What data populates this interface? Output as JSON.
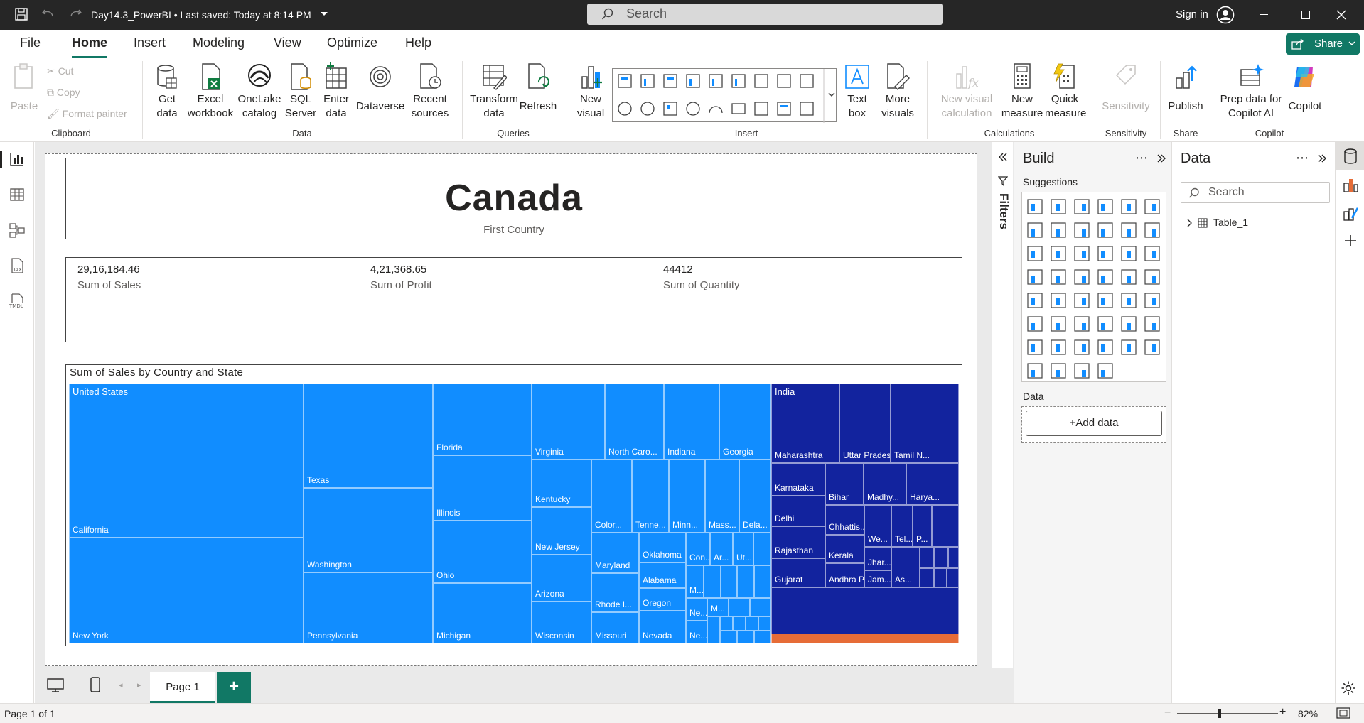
{
  "titlebar": {
    "doc_title": "Day14.3_PowerBI • Last saved: Today at 8:14 PM",
    "search_placeholder": "Search",
    "sign_in": "Sign in"
  },
  "tabs": [
    "File",
    "Home",
    "Insert",
    "Modeling",
    "View",
    "Optimize",
    "Help"
  ],
  "share_label": "Share",
  "ribbon": {
    "clipboard": {
      "paste": "Paste",
      "cut": "Cut",
      "copy": "Copy",
      "format_painter": "Format painter",
      "group": "Clipboard"
    },
    "data": {
      "get_data": "Get data",
      "excel": "Excel workbook",
      "onelake": "OneLake catalog",
      "sql": "SQL Server",
      "enter": "Enter data",
      "dataverse": "Dataverse",
      "recent": "Recent sources",
      "group": "Data"
    },
    "queries": {
      "transform": "Transform data",
      "refresh": "Refresh",
      "group": "Queries"
    },
    "insert": {
      "new_visual": "New visual",
      "text_box": "Text box",
      "more_visuals": "More visuals",
      "group": "Insert"
    },
    "calculations": {
      "new_visual_calc": "New visual calculation",
      "new_measure": "New measure",
      "quick_measure": "Quick measure",
      "group": "Calculations"
    },
    "sensitivity": {
      "label": "Sensitivity",
      "group": "Sensitivity"
    },
    "share": {
      "publish": "Publish",
      "group": "Share"
    },
    "copilot": {
      "prep": "Prep data for Copilot AI",
      "copilot": "Copilot",
      "group": "Copilot"
    }
  },
  "card": {
    "title": "Canada",
    "subtitle": "First Country"
  },
  "kpis": [
    {
      "value": "29,16,184.46",
      "label": "Sum of Sales"
    },
    {
      "value": "4,21,368.65",
      "label": "Sum of Profit"
    },
    {
      "value": "44412",
      "label": "Sum of Quantity"
    }
  ],
  "treemap": {
    "title": "Sum of Sales by Country and State",
    "colors": {
      "United States": "#118dff",
      "India": "#12239e",
      "Other": "#e66c37"
    },
    "labels": {
      "us": "United States",
      "in": "India",
      "california": "California",
      "newyork": "New York",
      "texas": "Texas",
      "washington": "Washington",
      "pennsylvania": "Pennsylvania",
      "florida": "Florida",
      "illinois": "Illinois",
      "ohio": "Ohio",
      "michigan": "Michigan",
      "virginia": "Virginia",
      "kentucky": "Kentucky",
      "newjersey": "New Jersey",
      "arizona": "Arizona",
      "wisconsin": "Wisconsin",
      "northcaro": "North Caro...",
      "indiana": "Indiana",
      "georgia": "Georgia",
      "colorado": "Color...",
      "tennessee": "Tenne...",
      "minnesota": "Minn...",
      "massachusetts": "Mass...",
      "delaware": "Dela...",
      "maryland": "Maryland",
      "rhode": "Rhode I...",
      "missouri": "Missouri",
      "oklahoma": "Oklahoma",
      "alabama": "Alabama",
      "oregon": "Oregon",
      "nevada": "Nevada",
      "connecticut": "Con...",
      "arkansas": "Ar...",
      "utah": "Ut...",
      "m1": "M...",
      "m2": "M...",
      "ne1": "Ne...",
      "ne2": "Ne...",
      "maharashtra": "Maharashtra",
      "uttarpradesh": "Uttar Pradesh",
      "tamilnadu": "Tamil N...",
      "karnataka": "Karnataka",
      "bihar": "Bihar",
      "madhya": "Madhy...",
      "haryana": "Harya...",
      "delhi": "Delhi",
      "chhattis": "Chhattis...",
      "we": "We...",
      "tel": "Tel...",
      "p": "P...",
      "rajasthan": "Rajasthan",
      "kerala": "Kerala",
      "jhar": "Jhar...",
      "gujarat": "Gujarat",
      "andhra": "Andhra P...",
      "jam": "Jam...",
      "as": "As..."
    }
  },
  "build": {
    "title": "Build",
    "suggestions": "Suggestions",
    "data_label": "Data",
    "add_data": "+Add data"
  },
  "data_pane": {
    "title": "Data",
    "search_placeholder": "Search",
    "table": "Table_1"
  },
  "filters_label": "Filters",
  "page_tab": "Page 1",
  "status": {
    "page": "Page 1 of 1",
    "zoom": "82%"
  }
}
